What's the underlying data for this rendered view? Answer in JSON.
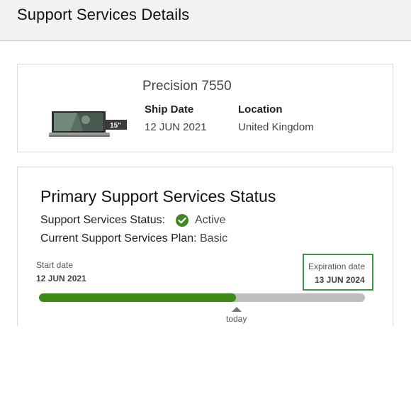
{
  "header": {
    "title": "Support Services Details"
  },
  "product": {
    "name": "Precision 7550",
    "screen_badge": "15\"",
    "ship_date_label": "Ship Date",
    "ship_date": "12 JUN 2021",
    "location_label": "Location",
    "location": "United Kingdom"
  },
  "status": {
    "title": "Primary Support Services Status",
    "status_label": "Support Services Status:",
    "status_value": "Active",
    "plan_label": "Current Support Services Plan:",
    "plan_value": "Basic",
    "start_label": "Start date",
    "start_value": "12 JUN 2021",
    "expiration_label": "Expiration date",
    "expiration_value": "13 JUN 2024",
    "today_label": "today",
    "elapsed_fraction": 0.605
  },
  "colors": {
    "accent_green": "#3c8a16",
    "track_gray": "#bdbdbd",
    "highlight_box": "#3a9a4a"
  }
}
